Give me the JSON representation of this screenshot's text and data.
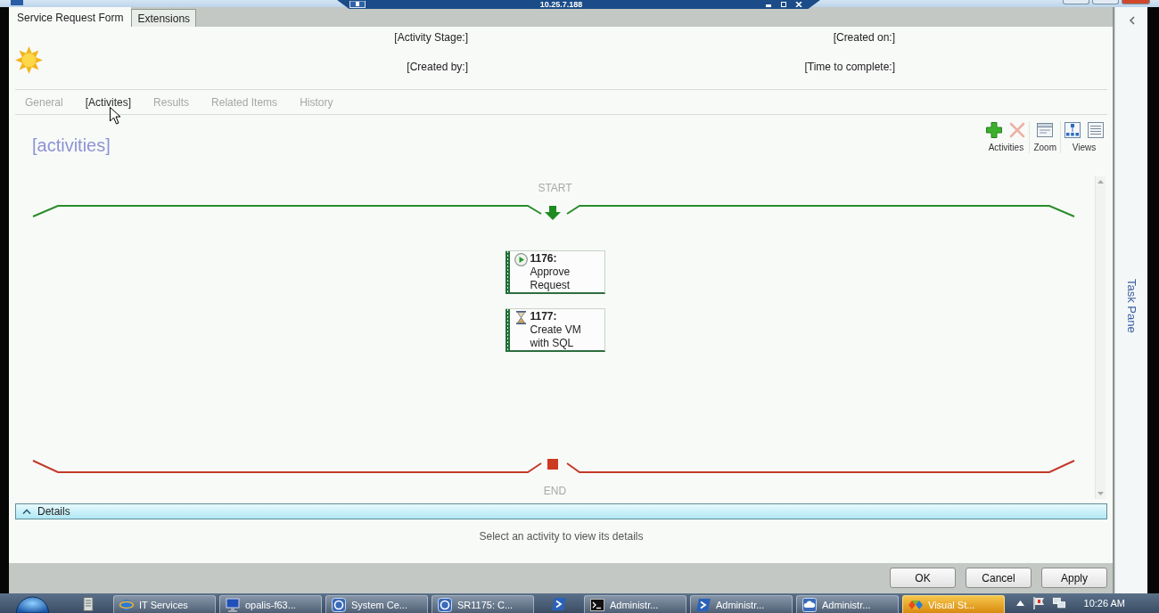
{
  "title_bar": {
    "remote_address": "10.25.7.188"
  },
  "form_tabs": [
    {
      "label": "Service Request Form",
      "selected": true
    },
    {
      "label": "Extensions",
      "selected": false
    }
  ],
  "header": {
    "fields": [
      {
        "label": "[Activity Stage:]"
      },
      {
        "label": "[Created on:]"
      },
      {
        "label": "[Created by:]"
      },
      {
        "label": "[Time to complete:]"
      }
    ]
  },
  "tabs": [
    {
      "label": "General",
      "selected": false
    },
    {
      "label": "[Activites]",
      "selected": true
    },
    {
      "label": "Results",
      "selected": false
    },
    {
      "label": "Related Items",
      "selected": false
    },
    {
      "label": "History",
      "selected": false
    }
  ],
  "section_title": "[activities]",
  "toolbar": [
    {
      "label": "Activities",
      "buttons": [
        {
          "kind": "add",
          "disabled": false
        },
        {
          "kind": "delete",
          "disabled": true
        }
      ]
    },
    {
      "label": "Zoom",
      "buttons": [
        {
          "kind": "zoom",
          "disabled": false
        }
      ]
    },
    {
      "label": "Views",
      "buttons": [
        {
          "kind": "tree",
          "disabled": false
        },
        {
          "kind": "list",
          "disabled": false
        }
      ]
    }
  ],
  "workflow": {
    "start_label": "START",
    "end_label": "END",
    "activities": [
      {
        "kind": "running",
        "number": "1176:",
        "title": "Approve Request"
      },
      {
        "kind": "waiting",
        "number": "1177:",
        "title": "Create VM with SQL"
      }
    ]
  },
  "details": {
    "title": "Details",
    "expanded": true,
    "message": "Select an activity to view its details"
  },
  "buttons": [
    "OK",
    "Cancel",
    "Apply"
  ],
  "task_pane": {
    "title": "Task Pane"
  },
  "taskbar": {
    "items": [
      {
        "kind": "pinned",
        "highlighted": false
      },
      {
        "kind": "window",
        "label": "IT Services",
        "highlighted": false
      },
      {
        "kind": "window",
        "label": "opalis-f63...",
        "highlighted": false
      },
      {
        "kind": "window",
        "label": "System Ce...",
        "highlighted": false
      },
      {
        "kind": "window",
        "label": "SR1175: C...",
        "highlighted": false
      },
      {
        "kind": "pinned",
        "highlighted": false
      },
      {
        "kind": "window",
        "label": "Administr...",
        "highlighted": false
      },
      {
        "kind": "window",
        "label": "Administr...",
        "highlighted": false
      },
      {
        "kind": "window",
        "label": "Administr...",
        "highlighted": false
      },
      {
        "kind": "window",
        "label": "Visual St...",
        "highlighted": true
      }
    ],
    "clock": "10:26 AM"
  }
}
